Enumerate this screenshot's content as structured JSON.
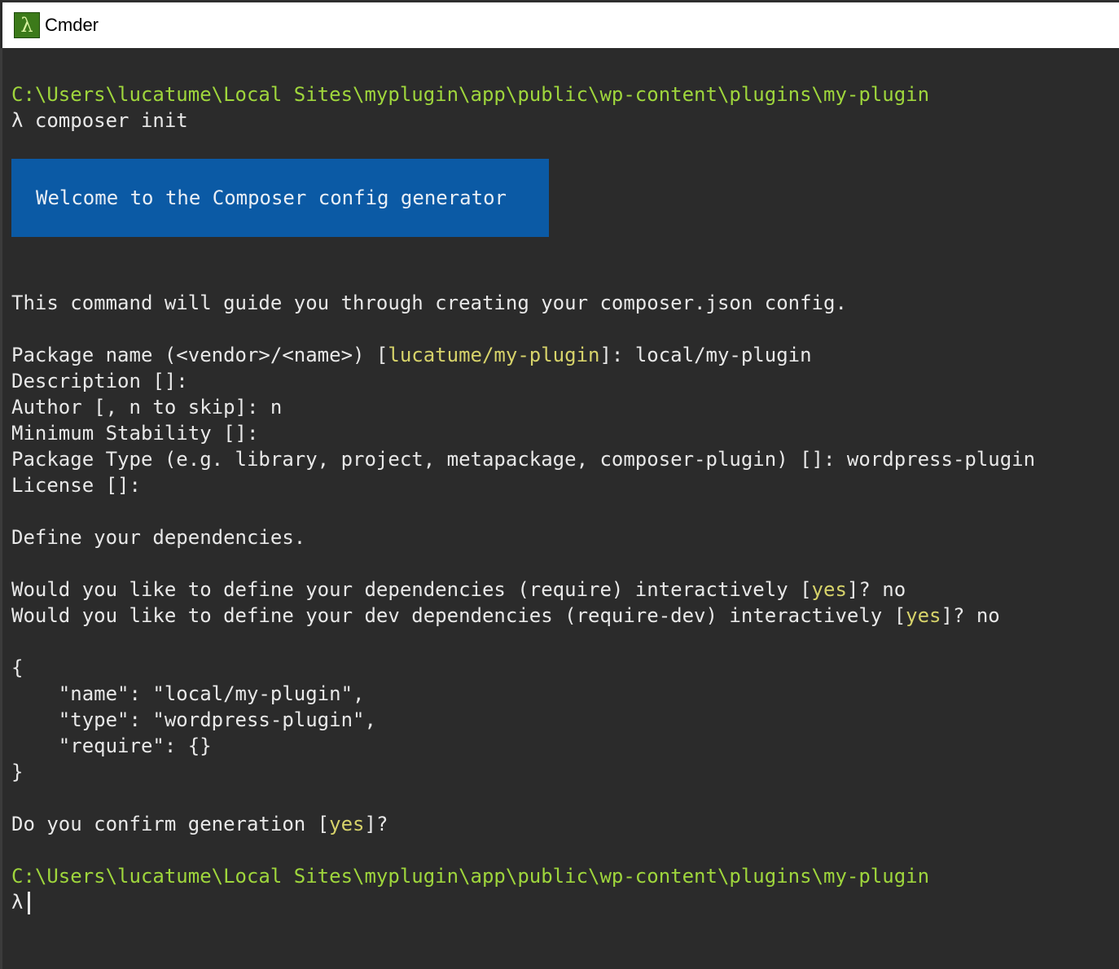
{
  "window": {
    "title": "Cmder",
    "icon": "lambda-icon",
    "colors": {
      "background": "#2b2b2b",
      "prompt_path": "#9fd63c",
      "highlight": "#d7d36a",
      "banner": "#0b5aa5"
    }
  },
  "terminal": {
    "path1": "C:\\Users\\lucatume\\Local Sites\\myplugin\\app\\public\\wp-content\\plugins\\my-plugin",
    "prompt_symbol": "λ",
    "command1": "composer init",
    "banner": "Welcome to the Composer config generator",
    "intro": "This command will guide you through creating your composer.json config.",
    "package_name": {
      "prefix": "Package name (<vendor>/<name>) [",
      "default": "lucatume/my-plugin",
      "suffix": "]: local/my-plugin"
    },
    "description": "Description []:",
    "author": "Author [, n to skip]: n",
    "min_stability": "Minimum Stability []:",
    "package_type": "Package Type (e.g. library, project, metapackage, composer-plugin) []: wordpress-plugin",
    "license": "License []:",
    "define_deps": "Define your dependencies.",
    "deps_q": {
      "prefix": "Would you like to define your dependencies (require) interactively [",
      "default": "yes",
      "suffix": "]? no"
    },
    "devdeps_q": {
      "prefix": "Would you like to define your dev dependencies (require-dev) interactively [",
      "default": "yes",
      "suffix": "]? no"
    },
    "json": {
      "open": "{",
      "name": "    \"name\": \"local/my-plugin\",",
      "type": "    \"type\": \"wordpress-plugin\",",
      "require": "    \"require\": {}",
      "close": "}"
    },
    "confirm": {
      "prefix": "Do you confirm generation [",
      "default": "yes",
      "suffix": "]?"
    },
    "path2": "C:\\Users\\lucatume\\Local Sites\\myplugin\\app\\public\\wp-content\\plugins\\my-plugin"
  }
}
